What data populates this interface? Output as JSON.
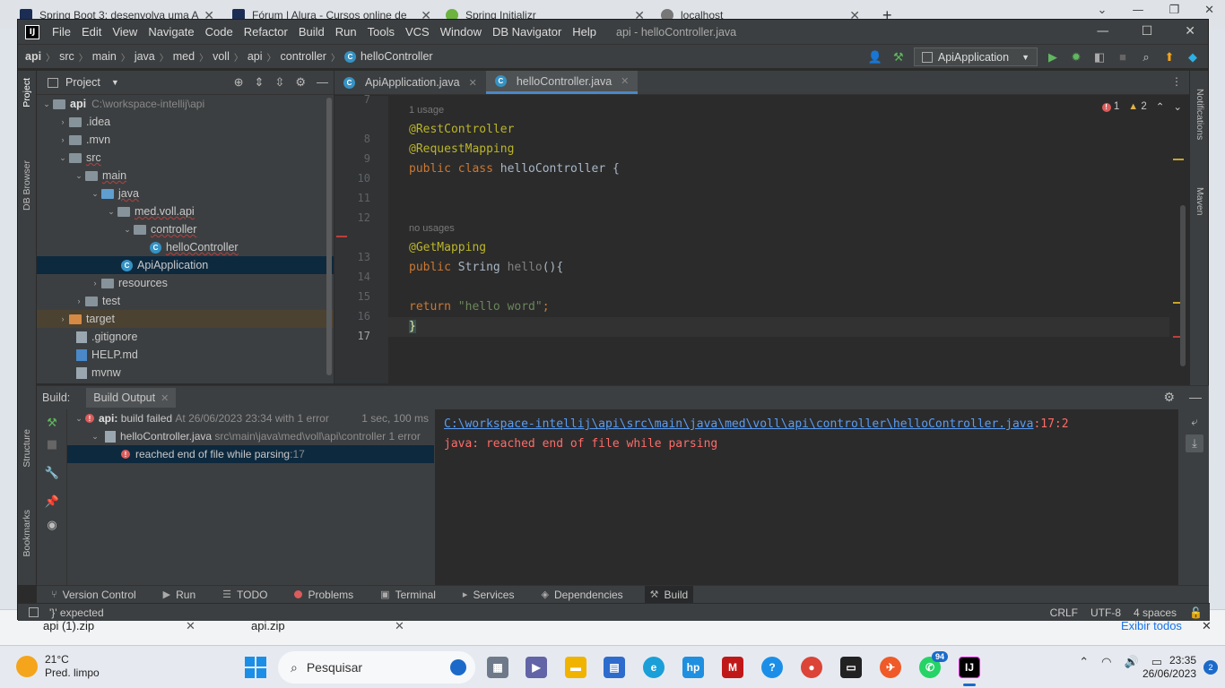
{
  "browser": {
    "tabs": [
      {
        "title": "Spring Boot 3: desenvolva uma A",
        "fav_color": "#1c2d55"
      },
      {
        "title": "Fórum | Alura - Cursos online de",
        "fav_color": "#1c2d55"
      },
      {
        "title": "Spring Initializr",
        "fav_color": "#6db33f"
      },
      {
        "title": "localhost",
        "fav_color": "#777777"
      }
    ]
  },
  "downloads": {
    "items": [
      "api (1).zip",
      "api.zip"
    ],
    "show_all": "Exibir todos"
  },
  "ide": {
    "menu": [
      "File",
      "Edit",
      "View",
      "Navigate",
      "Code",
      "Refactor",
      "Build",
      "Run",
      "Tools",
      "VCS",
      "Window",
      "DB Navigator",
      "Help"
    ],
    "window_title": "api - helloController.java",
    "breadcrumbs": [
      "api",
      "src",
      "main",
      "java",
      "med",
      "voll",
      "api",
      "controller",
      "helloController"
    ],
    "run_config": "ApiApplication",
    "left_strip": [
      "Project",
      "DB Browser",
      "Structure",
      "Bookmarks"
    ],
    "right_strip": [
      "Notifications",
      "Maven"
    ],
    "project": {
      "header": "Project",
      "root_name": "api",
      "root_path": "C:\\workspace-intellij\\api",
      "items": [
        ".idea",
        ".mvn",
        "src",
        "main",
        "java",
        "med.voll.api",
        "controller",
        "helloController",
        "ApiApplication",
        "resources",
        "test",
        "target",
        ".gitignore",
        "HELP.md",
        "mvnw"
      ]
    },
    "editor": {
      "tabs": [
        "ApiApplication.java",
        "helloController.java"
      ],
      "errors": "1",
      "warnings": "2",
      "hint_usage": "1 usage",
      "hint_no_usages": "no usages",
      "line_numbers": [
        "7",
        "8",
        "9",
        "10",
        "11",
        "12",
        "13",
        "14",
        "15",
        "16",
        "17"
      ],
      "code": {
        "l8": "@RestController",
        "l9": "@RequestMapping",
        "l10_kw": "public class",
        "l10_rest": " helloController {",
        "l13": "@GetMapping",
        "l14_kw": "public",
        "l14_type": " String ",
        "l14_meth": "hello",
        "l14_rest": "(){",
        "l16_kw": "return",
        "l16_str": " \"hello word\"",
        "l16_end": ";",
        "l17": "}"
      }
    },
    "build": {
      "title": "Build:",
      "tab": "Build Output",
      "status_prefix": "api:",
      "status": "build failed",
      "status_detail": "At 26/06/2023 23:34 with 1 error",
      "duration": "1 sec, 100 ms",
      "file": "helloController.java",
      "file_path": "src\\main\\java\\med\\voll\\api\\controller 1 error",
      "error_msg": "reached end of file while parsing",
      "error_line": ":17",
      "output_path": "C:\\workspace-intellij\\api\\src\\main\\java\\med\\voll\\api\\controller\\helloController.java",
      "output_pos": ":17:2",
      "output_msg": "java: reached end of file while parsing"
    },
    "tool_windows": [
      "Version Control",
      "Run",
      "TODO",
      "Problems",
      "Terminal",
      "Services",
      "Dependencies",
      "Build"
    ],
    "status": {
      "message": "'}' expected",
      "line_sep": "CRLF",
      "encoding": "UTF-8",
      "indent": "4 spaces"
    }
  },
  "taskbar": {
    "temp": "21°C",
    "weather": "Pred. limpo",
    "search": "Pesquisar",
    "whatsapp_badge": "94",
    "time": "23:35",
    "date": "26/06/2023",
    "notifications": "2"
  }
}
